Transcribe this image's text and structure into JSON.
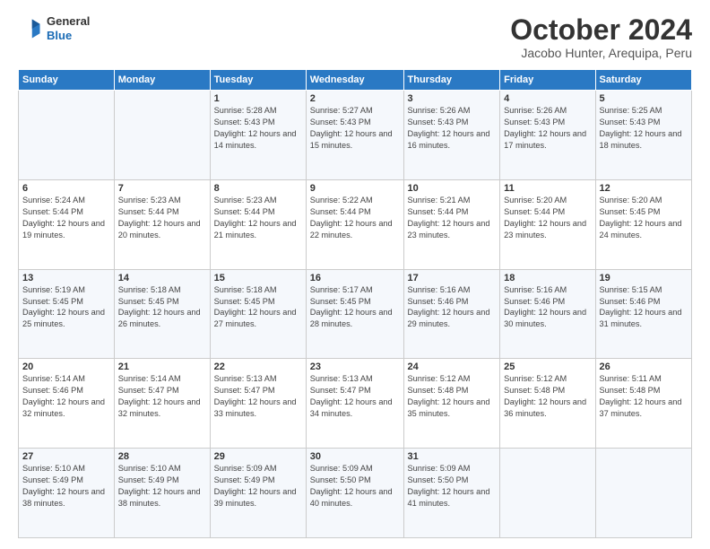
{
  "header": {
    "logo_general": "General",
    "logo_blue": "Blue",
    "month": "October 2024",
    "location": "Jacobo Hunter, Arequipa, Peru"
  },
  "days_of_week": [
    "Sunday",
    "Monday",
    "Tuesday",
    "Wednesday",
    "Thursday",
    "Friday",
    "Saturday"
  ],
  "weeks": [
    [
      {
        "day": "",
        "info": ""
      },
      {
        "day": "",
        "info": ""
      },
      {
        "day": "1",
        "info": "Sunrise: 5:28 AM\nSunset: 5:43 PM\nDaylight: 12 hours and 14 minutes."
      },
      {
        "day": "2",
        "info": "Sunrise: 5:27 AM\nSunset: 5:43 PM\nDaylight: 12 hours and 15 minutes."
      },
      {
        "day": "3",
        "info": "Sunrise: 5:26 AM\nSunset: 5:43 PM\nDaylight: 12 hours and 16 minutes."
      },
      {
        "day": "4",
        "info": "Sunrise: 5:26 AM\nSunset: 5:43 PM\nDaylight: 12 hours and 17 minutes."
      },
      {
        "day": "5",
        "info": "Sunrise: 5:25 AM\nSunset: 5:43 PM\nDaylight: 12 hours and 18 minutes."
      }
    ],
    [
      {
        "day": "6",
        "info": "Sunrise: 5:24 AM\nSunset: 5:44 PM\nDaylight: 12 hours and 19 minutes."
      },
      {
        "day": "7",
        "info": "Sunrise: 5:23 AM\nSunset: 5:44 PM\nDaylight: 12 hours and 20 minutes."
      },
      {
        "day": "8",
        "info": "Sunrise: 5:23 AM\nSunset: 5:44 PM\nDaylight: 12 hours and 21 minutes."
      },
      {
        "day": "9",
        "info": "Sunrise: 5:22 AM\nSunset: 5:44 PM\nDaylight: 12 hours and 22 minutes."
      },
      {
        "day": "10",
        "info": "Sunrise: 5:21 AM\nSunset: 5:44 PM\nDaylight: 12 hours and 23 minutes."
      },
      {
        "day": "11",
        "info": "Sunrise: 5:20 AM\nSunset: 5:44 PM\nDaylight: 12 hours and 23 minutes."
      },
      {
        "day": "12",
        "info": "Sunrise: 5:20 AM\nSunset: 5:45 PM\nDaylight: 12 hours and 24 minutes."
      }
    ],
    [
      {
        "day": "13",
        "info": "Sunrise: 5:19 AM\nSunset: 5:45 PM\nDaylight: 12 hours and 25 minutes."
      },
      {
        "day": "14",
        "info": "Sunrise: 5:18 AM\nSunset: 5:45 PM\nDaylight: 12 hours and 26 minutes."
      },
      {
        "day": "15",
        "info": "Sunrise: 5:18 AM\nSunset: 5:45 PM\nDaylight: 12 hours and 27 minutes."
      },
      {
        "day": "16",
        "info": "Sunrise: 5:17 AM\nSunset: 5:45 PM\nDaylight: 12 hours and 28 minutes."
      },
      {
        "day": "17",
        "info": "Sunrise: 5:16 AM\nSunset: 5:46 PM\nDaylight: 12 hours and 29 minutes."
      },
      {
        "day": "18",
        "info": "Sunrise: 5:16 AM\nSunset: 5:46 PM\nDaylight: 12 hours and 30 minutes."
      },
      {
        "day": "19",
        "info": "Sunrise: 5:15 AM\nSunset: 5:46 PM\nDaylight: 12 hours and 31 minutes."
      }
    ],
    [
      {
        "day": "20",
        "info": "Sunrise: 5:14 AM\nSunset: 5:46 PM\nDaylight: 12 hours and 32 minutes."
      },
      {
        "day": "21",
        "info": "Sunrise: 5:14 AM\nSunset: 5:47 PM\nDaylight: 12 hours and 32 minutes."
      },
      {
        "day": "22",
        "info": "Sunrise: 5:13 AM\nSunset: 5:47 PM\nDaylight: 12 hours and 33 minutes."
      },
      {
        "day": "23",
        "info": "Sunrise: 5:13 AM\nSunset: 5:47 PM\nDaylight: 12 hours and 34 minutes."
      },
      {
        "day": "24",
        "info": "Sunrise: 5:12 AM\nSunset: 5:48 PM\nDaylight: 12 hours and 35 minutes."
      },
      {
        "day": "25",
        "info": "Sunrise: 5:12 AM\nSunset: 5:48 PM\nDaylight: 12 hours and 36 minutes."
      },
      {
        "day": "26",
        "info": "Sunrise: 5:11 AM\nSunset: 5:48 PM\nDaylight: 12 hours and 37 minutes."
      }
    ],
    [
      {
        "day": "27",
        "info": "Sunrise: 5:10 AM\nSunset: 5:49 PM\nDaylight: 12 hours and 38 minutes."
      },
      {
        "day": "28",
        "info": "Sunrise: 5:10 AM\nSunset: 5:49 PM\nDaylight: 12 hours and 38 minutes."
      },
      {
        "day": "29",
        "info": "Sunrise: 5:09 AM\nSunset: 5:49 PM\nDaylight: 12 hours and 39 minutes."
      },
      {
        "day": "30",
        "info": "Sunrise: 5:09 AM\nSunset: 5:50 PM\nDaylight: 12 hours and 40 minutes."
      },
      {
        "day": "31",
        "info": "Sunrise: 5:09 AM\nSunset: 5:50 PM\nDaylight: 12 hours and 41 minutes."
      },
      {
        "day": "",
        "info": ""
      },
      {
        "day": "",
        "info": ""
      }
    ]
  ]
}
